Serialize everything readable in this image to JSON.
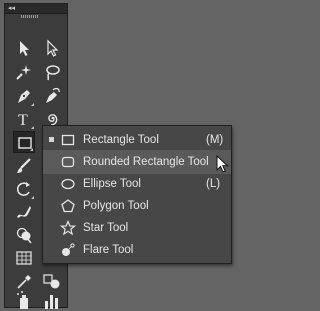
{
  "toolbar": {
    "collapse_label": "◂◂",
    "tools": [
      {
        "name": "selection-tool",
        "icon": "arrow-icon"
      },
      {
        "name": "direct-selection-tool",
        "icon": "hollow-arrow-icon"
      },
      {
        "name": "magic-wand-tool",
        "icon": "magic-wand-icon"
      },
      {
        "name": "lasso-tool",
        "icon": "lasso-icon"
      },
      {
        "name": "pen-tool",
        "icon": "pen-icon"
      },
      {
        "name": "curvature-tool",
        "icon": "curvature-pen-icon"
      },
      {
        "name": "type-tool",
        "icon": "type-icon",
        "glyph": "T"
      },
      {
        "name": "spiral-tool",
        "icon": "spiral-icon"
      },
      {
        "name": "rectangle-tool",
        "icon": "rectangle-icon",
        "selected": true
      },
      {
        "name": "paintbrush-tool",
        "icon": "brush-icon"
      },
      {
        "name": "rotate-tool",
        "icon": "rotate-icon"
      },
      {
        "name": "warp-tool",
        "icon": "warp-icon"
      },
      {
        "name": "shape-builder-tool",
        "icon": "shape-builder-icon"
      },
      {
        "name": "perspective-grid-tool",
        "icon": "perspective-grid-icon"
      },
      {
        "name": "eyedropper-tool",
        "icon": "eyedropper-icon"
      },
      {
        "name": "blend-tool",
        "icon": "blend-icon"
      },
      {
        "name": "symbol-sprayer-tool",
        "icon": "symbol-sprayer-icon"
      },
      {
        "name": "column-graph-tool",
        "icon": "bar-graph-icon"
      }
    ]
  },
  "flyout": {
    "items": [
      {
        "label": "Rectangle Tool",
        "shortcut": "(M)",
        "icon": "rectangle-icon",
        "active": true
      },
      {
        "label": "Rounded Rectangle Tool",
        "shortcut": "",
        "icon": "rounded-rectangle-icon",
        "hover": true
      },
      {
        "label": "Ellipse Tool",
        "shortcut": "(L)",
        "icon": "ellipse-icon"
      },
      {
        "label": "Polygon Tool",
        "shortcut": "",
        "icon": "polygon-icon"
      },
      {
        "label": "Star Tool",
        "shortcut": "",
        "icon": "star-icon"
      },
      {
        "label": "Flare Tool",
        "shortcut": "",
        "icon": "flare-icon"
      }
    ]
  },
  "colors": {
    "workspace": "#646464",
    "toolbar_bg": "#3c3c3c",
    "flyout_bg": "#474747",
    "flyout_highlight": "#5a5a5a",
    "text": "#e6e6e6"
  }
}
